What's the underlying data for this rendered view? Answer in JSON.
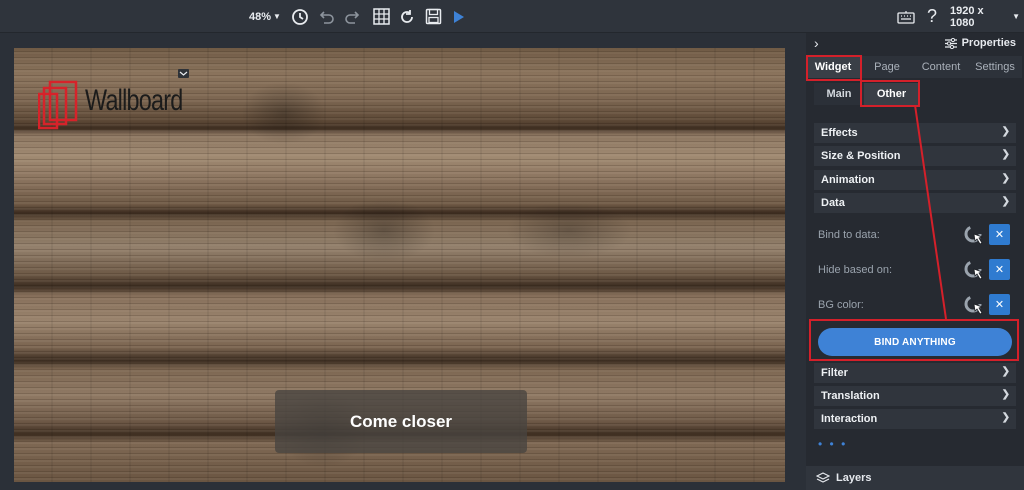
{
  "toolbar": {
    "zoom": "48%",
    "resolution": "1920 x 1080",
    "icons": [
      "history-icon",
      "undo-icon",
      "redo-icon",
      "grid-icon",
      "refresh-icon",
      "save-icon",
      "play-icon",
      "keyboard-icon",
      "help-icon"
    ]
  },
  "canvas": {
    "logo_text": "Wallboard",
    "text_widget": "Come closer"
  },
  "panel": {
    "title": "Properties",
    "tabs": [
      {
        "label": "Widget",
        "active": true
      },
      {
        "label": "Page"
      },
      {
        "label": "Content"
      },
      {
        "label": "Settings"
      }
    ],
    "subtabs": [
      {
        "label": "Main"
      },
      {
        "label": "Other",
        "active": true
      }
    ],
    "sections_top": [
      "Effects",
      "Size & Position",
      "Animation",
      "Data"
    ],
    "data_rows": [
      "Bind to data:",
      "Hide based on:",
      "BG color:"
    ],
    "bind_button": "BIND ANYTHING",
    "sections_bottom": [
      "Filter",
      "Translation",
      "Interaction"
    ],
    "more": "• • •",
    "layers": "Layers"
  },
  "colors": {
    "accent": "#3e82d6",
    "highlight": "#d4202a",
    "panel_bg": "#262a31"
  }
}
